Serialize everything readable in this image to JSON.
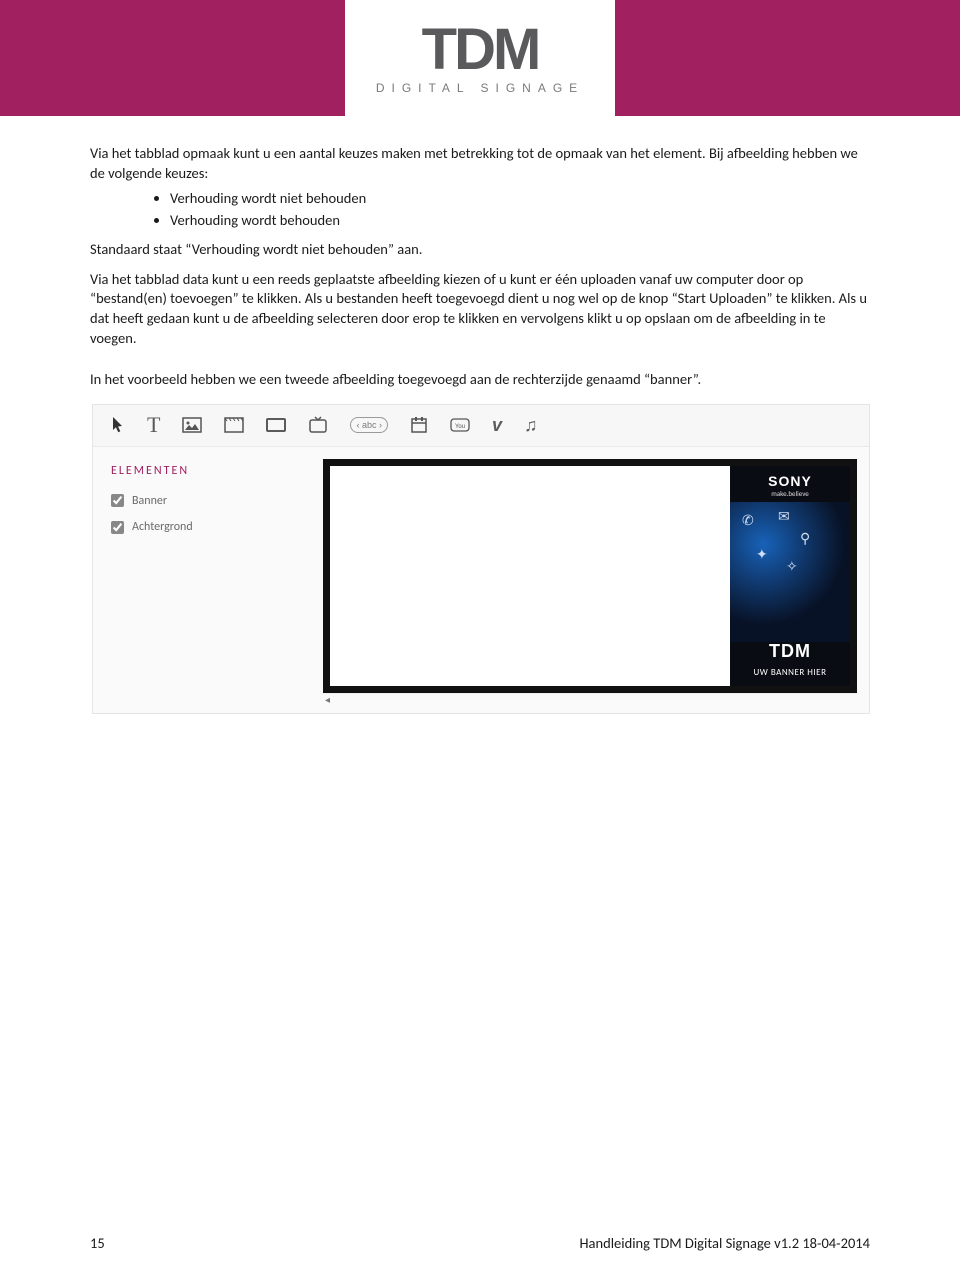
{
  "header": {
    "logo_main": "TDM",
    "logo_sub": "DIGITAL SIGNAGE"
  },
  "paragraphs": {
    "p1": "Via het tabblad opmaak kunt u een aantal keuzes maken met betrekking tot de opmaak van het element. Bij afbeelding hebben we de volgende keuzes:",
    "bullet1": "Verhouding wordt niet behouden",
    "bullet2": "Verhouding wordt behouden",
    "p2": "Standaard staat “Verhouding wordt niet behouden” aan.",
    "p3": "Via het tabblad data kunt u een reeds geplaatste afbeelding kiezen of u kunt er één uploaden vanaf uw computer door op “bestand(en) toevoegen” te klikken. Als u bestanden heeft toegevoegd dient u nog wel op de knop “Start Uploaden” te klikken. Als u dat heeft gedaan kunt u de afbeelding selecteren door erop te klikken en vervolgens klikt u op opslaan om de afbeelding in te voegen.",
    "p4": "In het voorbeeld hebben we een tweede afbeelding toegevoegd aan de rechterzijde genaamd “banner”."
  },
  "app": {
    "toolbar": {
      "abc_pill": "‹ abc ›"
    },
    "sidebar": {
      "title": "ELEMENTEN",
      "items": [
        {
          "label": "Banner",
          "checked": true
        },
        {
          "label": "Achtergrond",
          "checked": true
        }
      ]
    },
    "banner": {
      "brand": "SONY",
      "brand_sub": "make.believe",
      "mid_brand": "TDM",
      "caption": "UW BANNER HIER"
    }
  },
  "footer": {
    "page": "15",
    "doc": "Handleiding TDM Digital Signage v1.2 18-04-2014"
  }
}
